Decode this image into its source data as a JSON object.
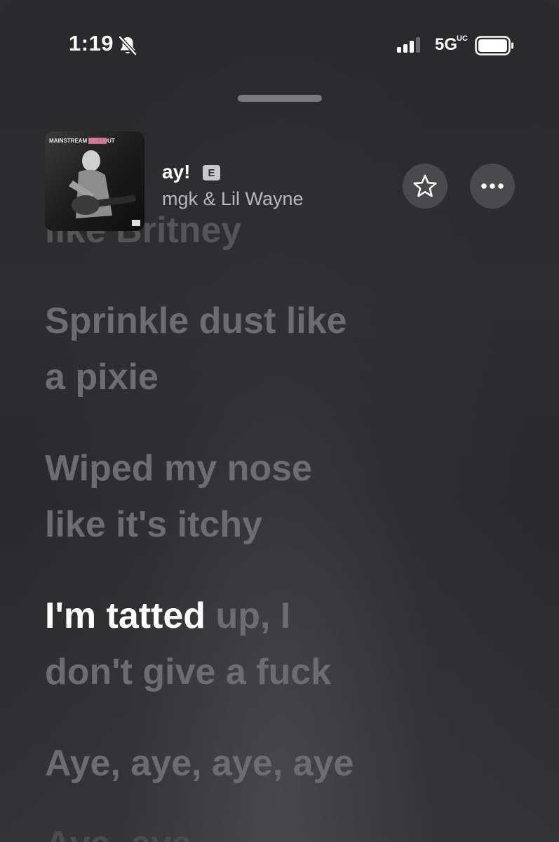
{
  "status_bar": {
    "time": "1:19",
    "network": "5G",
    "network_sub": "UC"
  },
  "now_playing": {
    "title": "ay!",
    "explicit_badge": "E",
    "artist": "mgk & Lil Wayne",
    "album_art_text": "MAINSTREAM SELLOUT"
  },
  "lyrics": {
    "previous_partial": "like Britney",
    "lines": [
      "Sprinkle dust like",
      "a pixie",
      "Wiped my nose",
      "like it's itchy"
    ],
    "current_sung": "I'm tatted",
    "current_rest": " up, I",
    "current_line2": "don't give a fuck",
    "next": "Aye, aye, aye, aye",
    "next_partial": "Aye, aye"
  },
  "icons": [
    "bell-slash-icon",
    "cellular-signal-icon",
    "battery-icon",
    "star-icon",
    "ellipsis-icon"
  ],
  "colors": {
    "background": "#2c2c2e",
    "inactive_lyric": "#6d6d6f",
    "active_lyric": "#ffffff",
    "button_bg": "#4a4a4c"
  }
}
